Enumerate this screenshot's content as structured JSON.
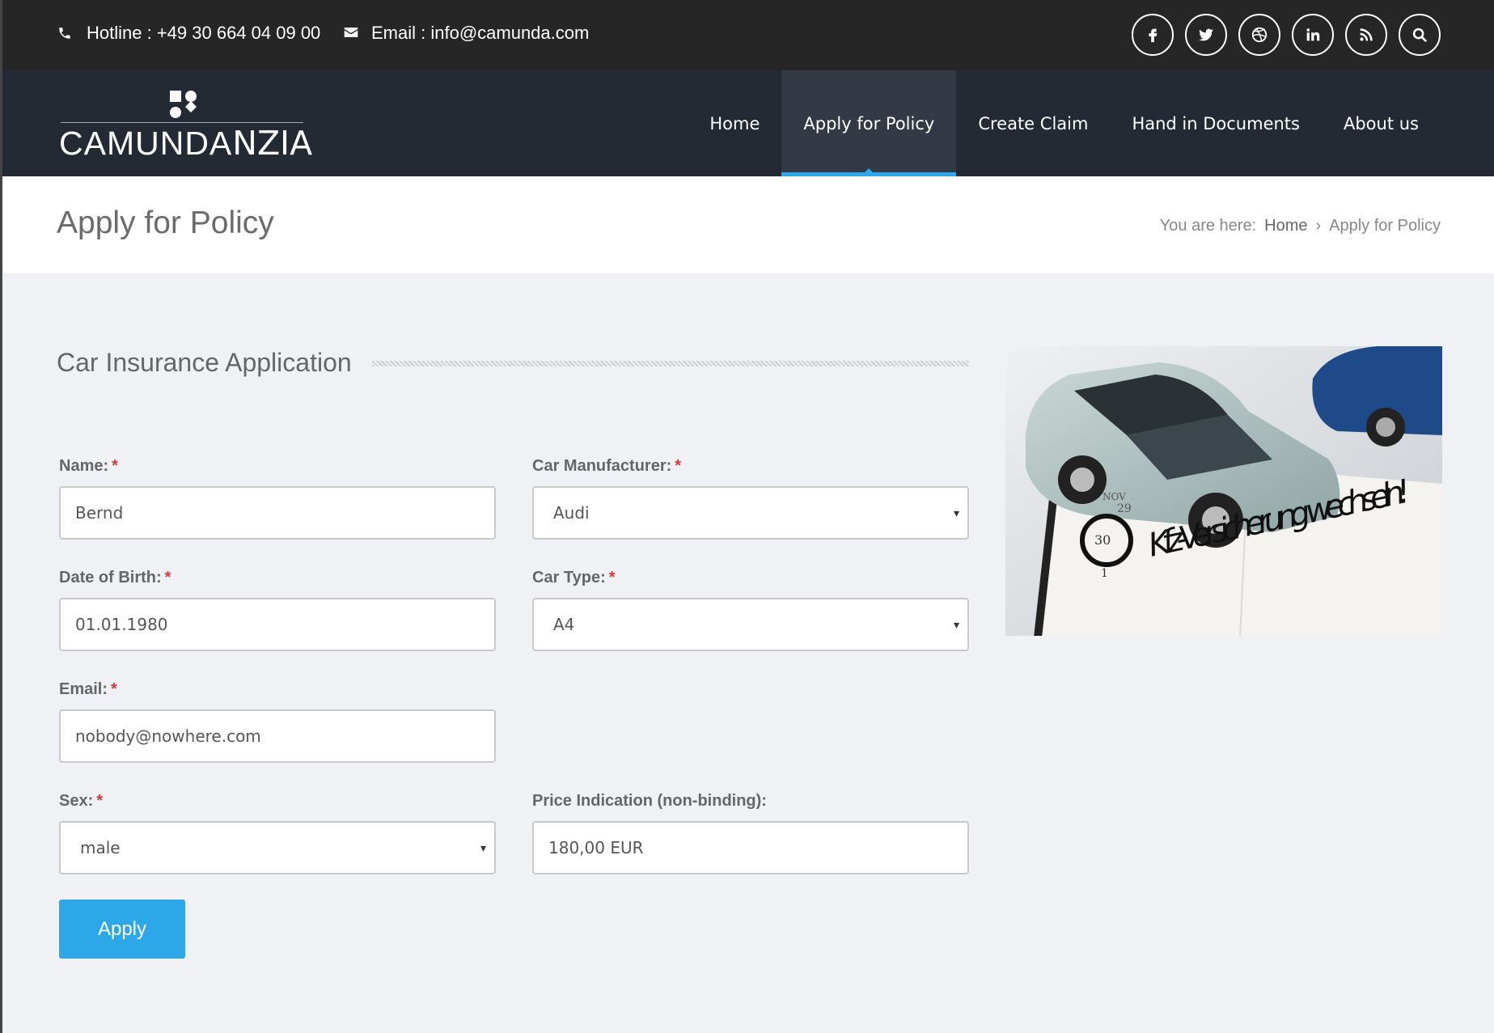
{
  "topbar": {
    "hotline": "Hotline : +49 30 664 04 09 00",
    "email": "Email : info@camunda.com",
    "social_icons": [
      "facebook-icon",
      "twitter-icon",
      "dribbble-icon",
      "linkedin-icon",
      "rss-icon",
      "search-icon"
    ]
  },
  "logo": {
    "text_bold": "CAMUNDA",
    "text_thin": "NZIA"
  },
  "nav": {
    "items": [
      {
        "label": "Home"
      },
      {
        "label": "Apply for Policy"
      },
      {
        "label": "Create Claim"
      },
      {
        "label": "Hand in Documents"
      },
      {
        "label": "About us"
      }
    ],
    "active_label": "Apply for Policy"
  },
  "title": {
    "heading": "Apply for Policy",
    "breadcrumb_prefix": "You are here:",
    "breadcrumb_home": "Home",
    "breadcrumb_sep": "›",
    "breadcrumb_current": "Apply for Policy"
  },
  "form": {
    "section_title": "Car Insurance Application",
    "required_mark": "*",
    "name": {
      "label": "Name:",
      "value": "Bernd"
    },
    "dob": {
      "label": "Date of Birth:",
      "value": "01.01.1980"
    },
    "email": {
      "label": "Email:",
      "value": "nobody@nowhere.com"
    },
    "sex": {
      "label": "Sex:",
      "value": "male"
    },
    "manufacturer": {
      "label": "Car Manufacturer:",
      "value": "Audi"
    },
    "car_type": {
      "label": "Car Type:",
      "value": "A4"
    },
    "price": {
      "label": "Price Indication (non-binding):",
      "value": "180,00 EUR"
    },
    "select_arrow": "▾",
    "apply_label": "Apply"
  },
  "hero": {
    "handwriting": "Kfz-Versicherung wechseln!",
    "cal_month": "NOV",
    "cal_day1": "29",
    "cal_day2": "30",
    "cal_day3": "1"
  },
  "colors": {
    "accent": "#2ca8e8",
    "nav_bg": "#232a34",
    "topbar_bg": "#262626",
    "required": "#d43b3b"
  }
}
